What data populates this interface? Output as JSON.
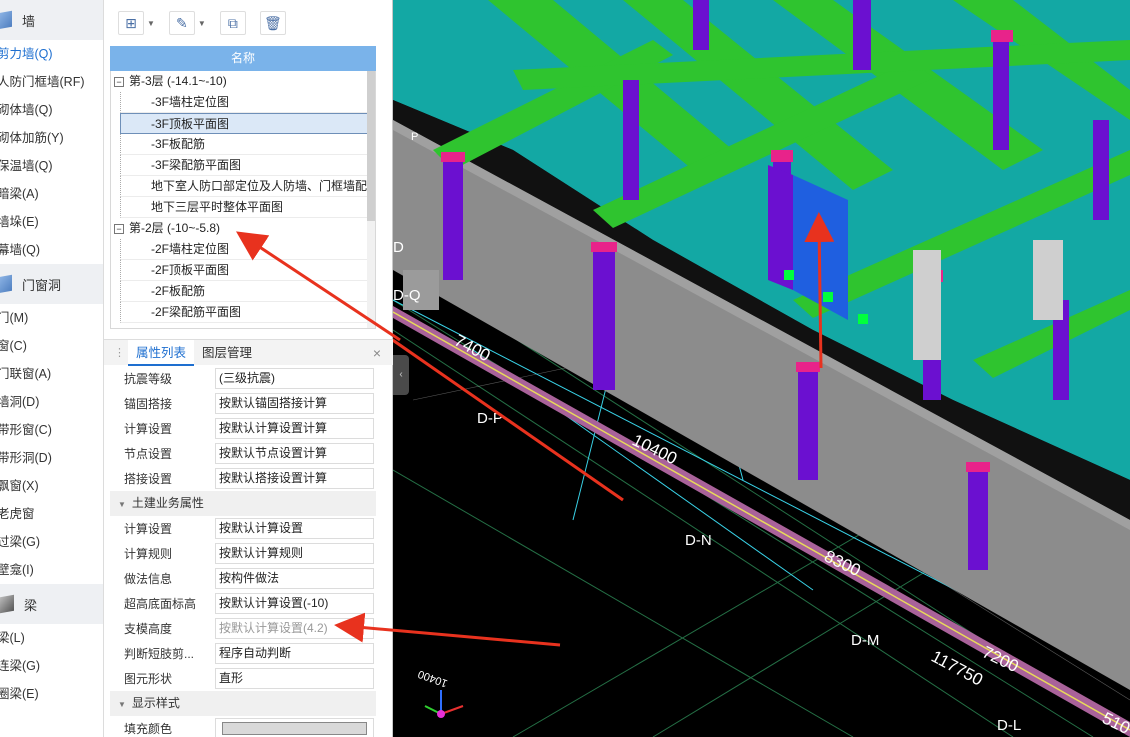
{
  "nav": {
    "group_wall": "墙",
    "items_wall": [
      "剪力墙(Q)",
      "人防门框墙(RF)",
      "砌体墙(Q)",
      "砌体加筋(Y)",
      "保温墙(Q)",
      "暗梁(A)",
      "墙垛(E)",
      "幕墙(Q)"
    ],
    "group_opening": "门窗洞",
    "items_opening": [
      "门(M)",
      "窗(C)",
      "门联窗(A)",
      "墙洞(D)",
      "带形窗(C)",
      "带形洞(D)",
      "飘窗(X)",
      "老虎窗",
      "过梁(G)",
      "壁龛(I)"
    ],
    "group_beam": "梁",
    "items_beam": [
      "梁(L)",
      "连梁(G)",
      "圈梁(E)"
    ]
  },
  "toolbar": {
    "icons": [
      "new-icon",
      "edit-icon",
      "copy-icon",
      "delete-icon"
    ]
  },
  "tree": {
    "header": "名称",
    "floor1": "第-3层 (-14.1~-10)",
    "floor1_items": [
      "-3F墙柱定位图",
      "-3F顶板平面图",
      "-3F板配筋",
      "-3F梁配筋平面图",
      "地下室人防口部定位及人防墙、门框墙配...",
      "地下三层平时整体平面图"
    ],
    "floor2": "第-2层 (-10~-5.8)",
    "floor2_items": [
      "-2F墙柱定位图",
      "-2F顶板平面图",
      "-2F板配筋",
      "-2F梁配筋平面图"
    ]
  },
  "tabs": {
    "properties": "属性列表",
    "layers": "图层管理",
    "close": "×"
  },
  "properties": {
    "rows1": [
      {
        "k": "抗震等级",
        "v": "(三级抗震)"
      },
      {
        "k": "锚固搭接",
        "v": "按默认锚固搭接计算"
      },
      {
        "k": "计算设置",
        "v": "按默认计算设置计算"
      },
      {
        "k": "节点设置",
        "v": "按默认节点设置计算"
      },
      {
        "k": "搭接设置",
        "v": "按默认搭接设置计算"
      }
    ],
    "section_civil": "土建业务属性",
    "rows2": [
      {
        "k": "计算设置",
        "v": "按默认计算设置"
      },
      {
        "k": "计算规则",
        "v": "按默认计算规则"
      },
      {
        "k": "做法信息",
        "v": "按构件做法"
      },
      {
        "k": "超高底面标高",
        "v": "按默认计算设置(-10)"
      },
      {
        "k": "支模高度",
        "v": "按默认计算设置(4.2)"
      },
      {
        "k": "判断短肢剪...",
        "v": "程序自动判断"
      },
      {
        "k": "图元形状",
        "v": "直形"
      }
    ],
    "section_display": "显示样式",
    "fill_color_label": "填充颜色",
    "fill_color": "#d9d9d9"
  },
  "viewport": {
    "labels": {
      "d_q": "D-Q",
      "d_p": "D-P",
      "d_n": "D-N",
      "d_m": "D-M",
      "d_l": "D-L",
      "d_top": "D",
      "p_small": "P",
      "dim_7400": "7400",
      "dim_10400": "10400",
      "dim_8300": "8300",
      "dim_7200": "7200",
      "dim_117750": "117750",
      "dim_510": "510",
      "dim_10400b": "10400"
    },
    "colors": {
      "wall": "#8c8c8c",
      "column": "#6b10d0",
      "beam": "#2fc42f",
      "slab": "#18b5b0",
      "cap": "#e8238a",
      "highlight": "#1f5fe0",
      "arrow": "#e8321e"
    }
  }
}
